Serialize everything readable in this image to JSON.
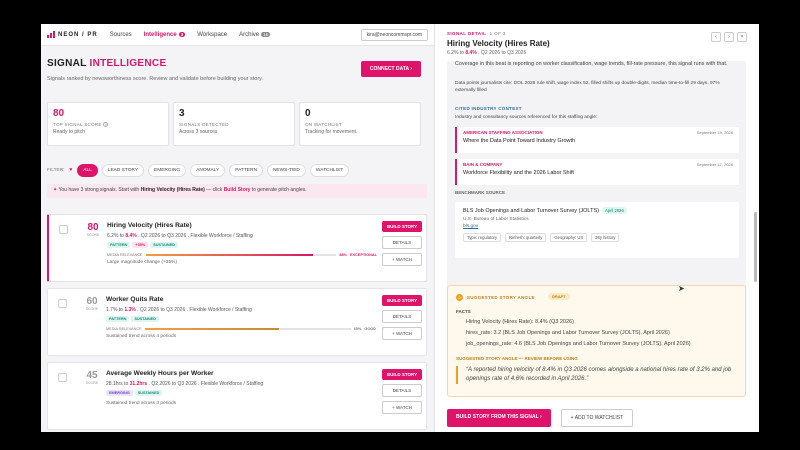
{
  "nav": {
    "logo": "NEON / PR",
    "links": [
      {
        "label": "Sources"
      },
      {
        "label": "Intelligence",
        "badge": "3"
      },
      {
        "label": "Workspace"
      },
      {
        "label": "Archive",
        "badge": "16"
      }
    ],
    "email": "kira@neoncommspr.com"
  },
  "header": {
    "title_a": "SIGNAL ",
    "title_b": "INTELLIGENCE",
    "subtitle": "Signals ranked by newsworthiness score. Review and validate before building your story.",
    "connect": "CONNECT DATA ›"
  },
  "stats": [
    {
      "value": "80",
      "label": "TOP SIGNAL SCORE",
      "sub": "Ready to pitch"
    },
    {
      "value": "3",
      "label": "SIGNALS DETECTED",
      "sub": "Across 3 sources"
    },
    {
      "value": "0",
      "label": "ON WATCHLIST",
      "sub": "Tracking for movement."
    }
  ],
  "filters": {
    "label": "FILTER:",
    "chips": [
      "ALL",
      "LEAD STORY",
      "EMERGING",
      "ANOMALY",
      "PATTERN",
      "NEWS-TIED",
      "WATCHLIST"
    ]
  },
  "banner": {
    "a": "You have 3 strong signals. Start with ",
    "b": "Hiring Velocity (Hires Rate)",
    "c": " — click ",
    "d": "Build Story",
    "e": " to generate pitch angles."
  },
  "signals": [
    {
      "score": "80",
      "score_label": "SCORE",
      "title": "Hiring Velocity (Hires Rate)",
      "meta_a": "6.2% to ",
      "meta_b": "8.4%",
      "meta_c": " . Q2 2026 to Q3 2026 . Flexible Workforce / Staffing",
      "tags": [
        "PATTERN",
        "+35%",
        "SUSTAINED"
      ],
      "rel_label": "MEDIA RELEVANCE",
      "rel_pct": "88%",
      "rel_word": "EXCEPTIONAL",
      "rel_value": 0.88,
      "foot": "Large magnitude change (+35%)",
      "buttons": [
        "BUILD STORY",
        "DETAILS",
        "+ WATCH"
      ]
    },
    {
      "score": "60",
      "score_label": "SCORE",
      "title": "Worker Quits Rate",
      "meta_a": "1.7% to ",
      "meta_b": "1.3%",
      "meta_c": " . Q2 2026 to Q3 2026 . Flexible Workforce / Staffing",
      "tags": [
        "PATTERN",
        "SUSTAINED"
      ],
      "rel_label": "MEDIA RELEVANCE",
      "rel_pct": "65%",
      "rel_word": "GOOD",
      "rel_value": 0.65,
      "foot": "Sustained trend across 4 periods",
      "buttons": [
        "BUILD STORY",
        "DETAILS",
        "+ WATCH"
      ]
    },
    {
      "score": "45",
      "score_label": "SCORE",
      "title": "Average Weekly Hours per Worker",
      "meta_a": "28.1hrs to ",
      "meta_b": "31.2hrs",
      "meta_c": " . Q2 2026 to Q3 2026 . Flexible Workforce / Staffing",
      "tags": [
        "EMERGING",
        "SUSTAINED"
      ],
      "foot": "Sustained trend across 3 periods",
      "buttons": [
        "BUILD STORY",
        "DETAILS",
        "+ WATCH"
      ]
    }
  ],
  "detail": {
    "cap_a": "SIGNAL DETAIL",
    "cap_b": "1 OF 3",
    "title": "Hiring Velocity (Hires Rate)",
    "sub_a": "6.2% to ",
    "sub_b": "8.4%",
    "sub_c": " . Q2 2026 to Q3 2026",
    "nav": [
      "‹",
      "›",
      "×"
    ],
    "coverage": "Coverage in this beat is reporting on worker classification, wage trends, fill-rate pressure, this signal runs with that.",
    "datapoints": "Data points journalists cite: DOL 2026 rule shift, wage index 52, filled shifts up double-digits, median time-to-fill 29 days, 97% externally filled",
    "cited_hdr": "CITED INDUSTRY CONTEXT",
    "cited_sub": "Industry and consultancy sources referenced for this staffing angle:",
    "sources": [
      {
        "org": "AMERICAN STAFFING ASSOCIATION",
        "date": "September 19, 2026",
        "title": "Where the Data Point Toward Industry Growth"
      },
      {
        "org": "BAIN & COMPANY",
        "date": "September 17, 2026",
        "title": "Workforce Flexibility and the 2026 Labor Shift"
      }
    ],
    "bench_hdr": "BENCHMARK SOURCE",
    "bench": {
      "title": "BLS Job Openings and Labor Turnover Survey (JOLTS)",
      "pill": "April 2026",
      "org": "U.S. Bureau of Labor Statistics",
      "link": "bls.gov",
      "tags": [
        "Type: regulatory",
        "Refresh: quarterly",
        "Geography: US",
        "26y history"
      ]
    },
    "story": {
      "icon": "2",
      "hdr": "SUGGESTED STORY ANGLE",
      "draft": "DRAFT",
      "facts_hdr": "FACTS",
      "facts": [
        "Hiring Velocity (Hires Rate): 8.4% (Q3 2026)",
        "hires_rate: 3.2 (BLS Job Openings and Labor Turnover Survey (JOLTS), April 2026)",
        "job_openings_rate: 4.6 (BLS Job Openings and Labor Turnover Survey (JOLTS), April 2026)"
      ],
      "sub": "SUGGESTED STORY ANGLE — REVIEW BEFORE USING",
      "quote": "“A reported hiring velocity of 8.4% in Q3 2026 comes alongside a national hires rate of 3.2% and job openings rate of 4.6% recorded in April 2026.”"
    },
    "build": "BUILD STORY FROM THIS SIGNAL ›",
    "watch": "+ ADD TO WATCHLIST"
  },
  "colors": {
    "accent": "#d6186a",
    "teal": "#168a78",
    "amber": "#f0a020"
  }
}
